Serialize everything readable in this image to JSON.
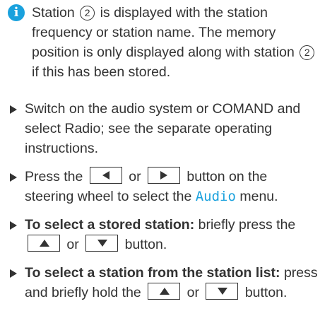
{
  "note": {
    "icon": "info-icon",
    "icon_glyph": "i",
    "t1": "Station",
    "ref": "2",
    "t2": "is displayed with the station frequency or station name. The memory position is only displayed along with station",
    "t3": "if this has been stored."
  },
  "steps": [
    {
      "text": "Switch on the audio system or COMAND and select Radio; see the separate operating instructions."
    },
    {
      "pre": "Press the",
      "mid": "or",
      "post1": "button on the steering wheel to select the",
      "menu": "Audio",
      "post2": "menu."
    },
    {
      "bold": "To select a stored station:",
      "pre": "briefly press the",
      "mid": "or",
      "post": "button."
    },
    {
      "bold": "To select a station from the station list:",
      "pre": "press and briefly hold the",
      "mid": "or",
      "post": "button."
    }
  ],
  "icons": {
    "left": "left-arrow-key-icon",
    "right": "right-arrow-key-icon",
    "up": "up-arrow-key-icon",
    "down": "down-arrow-key-icon"
  },
  "colors": {
    "accent": "#1aa1dd",
    "text": "#333333"
  }
}
